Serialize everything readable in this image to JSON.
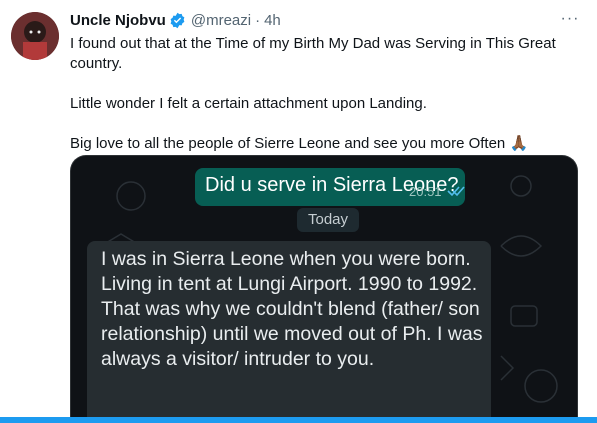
{
  "tweet": {
    "name": "Uncle Njobvu",
    "handle": "@mreazi",
    "separator": "·",
    "time": "4h",
    "more_icon": "···",
    "lines": [
      "I found out that at the Time of my Birth My Dad was Serving in This Great country.",
      "Little wonder I felt a certain attachment upon Landing.",
      "Big love to all the people of Sierre Leone and see you more Often 🙏🏾"
    ]
  },
  "chat": {
    "outgoing": {
      "text": "Did u serve in Sierra Leone?",
      "time": "20:51"
    },
    "date_divider": "Today",
    "incoming": {
      "lines": [
        "I was in Sierra Leone when you were born. Living in tent at Lungi Airport. 1990 to 1992.",
        "That was why we couldn't blend (father/ son relationship) until we moved out of Ph. I was always a visitor/ intruder to you."
      ]
    }
  },
  "colors": {
    "accent": "#1d9bf0",
    "chat_bg": "#0f1216",
    "outgoing_bubble": "#075e54",
    "incoming_bubble": "#262d31",
    "read_ticks": "#53bdeb"
  }
}
